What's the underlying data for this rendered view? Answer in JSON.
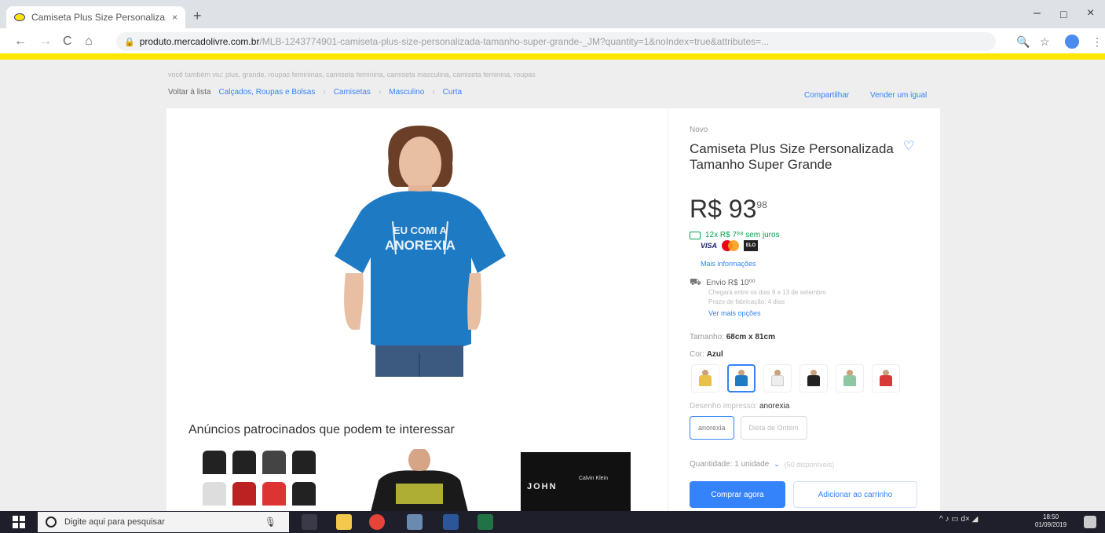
{
  "browser": {
    "tab_title": "Camiseta Plus Size Personaliza",
    "tab_close": "×",
    "new_tab": "+",
    "url_domain": "produto.mercadolivre.com.br",
    "url_path": "/MLB-1243774901-camiseta-plus-size-personalizada-tamanho-super-grande-_JM?quantity=1&noIndex=true&attributes=...",
    "minimize": "–",
    "maximize": "□",
    "close": "×",
    "back": "←",
    "forward": "→",
    "reload": "C",
    "home": "⌂",
    "zoom": "🔍",
    "star": "☆",
    "menu": "⋮"
  },
  "breadcrumb": {
    "top": "você também viu: plus, grande, roupas femininas, camiseta feminina, camiseta masculina, camiseta feminina, roupas",
    "back": "Voltar à lista",
    "items": [
      "Calçados, Roupas e Bolsas",
      "Camisetas",
      "Masculino",
      "Curta"
    ],
    "sep": "›",
    "share": "Compartilhar",
    "sell": "Vender um igual"
  },
  "product": {
    "condition": "Novo",
    "title": "Camiseta Plus Size Personalizada Tamanho Super Grande",
    "price_currency": "R$",
    "price_int": "93",
    "price_cents": "98",
    "installments": "12x R$ 7⁸⁸ sem juros",
    "visa": "VISA",
    "elo": "ELO",
    "more_info": "Mais informações",
    "shipping": "Envio R$ 10⁰⁰",
    "shipping_line1": "Chegará entre os dias 9 e 13 de setembro",
    "shipping_line2": "Prazo de fabricação: 4 dias",
    "shipping_more": "Ver mais opções",
    "size_label": "Tamanho:",
    "size_value": "68cm x 81cm",
    "color_label": "Cor:",
    "color_value": "Azul",
    "swatch_colors": [
      "#e8c04a",
      "#1f7ac4",
      "#eeeeee",
      "#222222",
      "#8ec8a2",
      "#d83a3a"
    ],
    "design_label": "Desenho impresso:",
    "design_value": "anorexia",
    "design_options": [
      "anorexia",
      "Dieta de Ontem"
    ],
    "qty_label": "Quantidade: 1 unidade",
    "qty_chevron": "⌄",
    "qty_avail": "(50 disponíveis)",
    "buy": "Comprar agora",
    "cart": "Adicionar ao carrinho",
    "heart": "♡",
    "shirt_text_1": "EU COMI A",
    "shirt_text_2": "ANOREXIA"
  },
  "ads": {
    "title": "Anúncios patrocinados que podem te interessar",
    "ad3_text": "JOHN",
    "ad3_brand": "Calvin Klein"
  },
  "taskbar": {
    "search_placeholder": "Digite aqui para pesquisar",
    "mic": "🎙",
    "time": "18:50",
    "date": "01/09/2019",
    "tray": "^ ♪ ▭ d× ◢"
  },
  "colors": {
    "accent": "#3483fa",
    "brand_yellow": "#ffe600",
    "green": "#00a650",
    "shirt_blue": "#1f7ac4"
  }
}
